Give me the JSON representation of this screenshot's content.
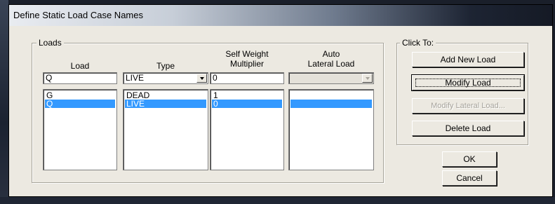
{
  "window": {
    "title": "Define Static Load Case Names"
  },
  "loads_group": {
    "label": "Loads",
    "headers": {
      "load": "Load",
      "type": "Type",
      "self_weight_line1": "Self Weight",
      "self_weight_line2": "Multiplier",
      "auto_lateral_line1": "Auto",
      "auto_lateral_line2": "Lateral Load"
    },
    "edit_row": {
      "load": "Q",
      "type": "LIVE",
      "self_weight": "0",
      "auto_lateral": ""
    },
    "rows": [
      {
        "load": "G",
        "type": "DEAD",
        "self_weight": "1",
        "auto_lateral": "",
        "selected": false
      },
      {
        "load": "Q",
        "type": "LIVE",
        "self_weight": "0",
        "auto_lateral": "",
        "selected": true
      }
    ]
  },
  "click_to_group": {
    "label": "Click To:",
    "add_new_load": "Add New Load",
    "modify_load": "Modify Load",
    "modify_lateral_load": "Modify Lateral Load...",
    "delete_load": "Delete Load"
  },
  "buttons": {
    "ok": "OK",
    "cancel": "Cancel"
  },
  "colors": {
    "selection": "#3399ff",
    "dialog_bg": "#ece9e1"
  },
  "icons": {
    "dropdown": "chevron-down-icon"
  }
}
